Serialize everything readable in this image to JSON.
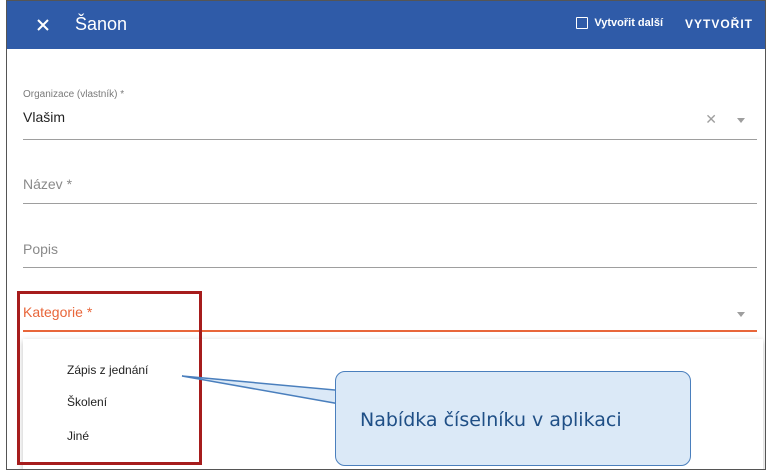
{
  "appbar": {
    "title": "Šanon",
    "create_another_label": "Vytvořit další",
    "create_label": "VYTVOŘIT"
  },
  "form": {
    "organization": {
      "label": "Organizace (vlastník) *",
      "value": "Vlašim"
    },
    "name": {
      "placeholder": "Název *"
    },
    "description": {
      "placeholder": "Popis"
    },
    "category": {
      "label": "Kategorie *",
      "accent_color": "#e8663a"
    }
  },
  "category_menu": {
    "items": [
      "Zápis z jednání",
      "Školení",
      "Jiné"
    ]
  },
  "annotation": {
    "callout_text": "Nabídka číselníku v aplikaci",
    "box_color": "#a61c1c",
    "callout_fill": "#dbe9f7"
  },
  "colors": {
    "appbar": "#2f5ba8"
  }
}
